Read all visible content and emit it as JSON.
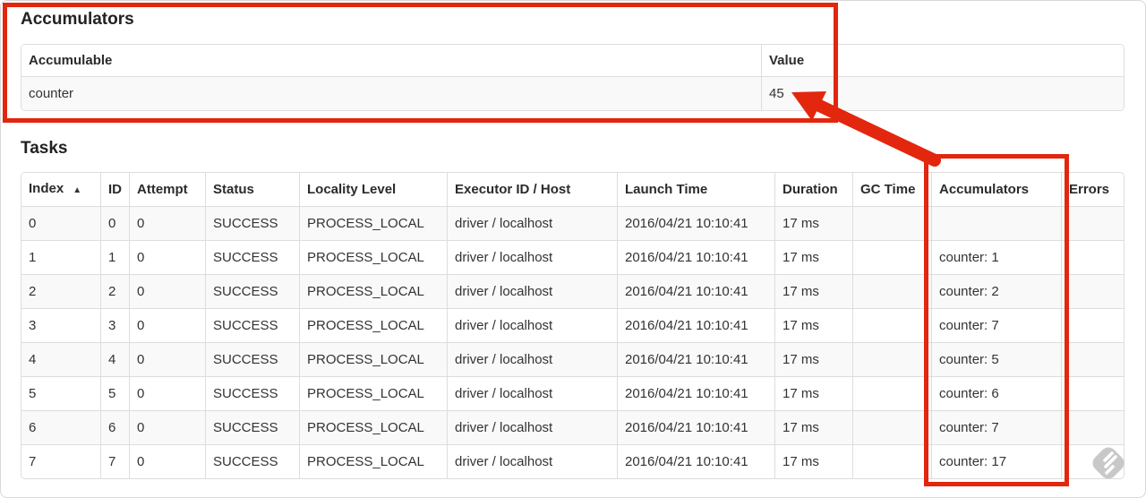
{
  "accumulators_section": {
    "title": "Accumulators",
    "table": {
      "headers": [
        "Accumulable",
        "Value"
      ],
      "rows": [
        [
          "counter",
          "45"
        ]
      ]
    }
  },
  "tasks_section": {
    "title": "Tasks",
    "table": {
      "headers": [
        "Index",
        "ID",
        "Attempt",
        "Status",
        "Locality Level",
        "Executor ID / Host",
        "Launch Time",
        "Duration",
        "GC Time",
        "Accumulators",
        "Errors"
      ],
      "sort_column": 0,
      "sort_glyph": "▲",
      "rows": [
        [
          "0",
          "0",
          "0",
          "SUCCESS",
          "PROCESS_LOCAL",
          "driver / localhost",
          "2016/04/21 10:10:41",
          "17 ms",
          "",
          "",
          ""
        ],
        [
          "1",
          "1",
          "0",
          "SUCCESS",
          "PROCESS_LOCAL",
          "driver / localhost",
          "2016/04/21 10:10:41",
          "17 ms",
          "",
          "counter: 1",
          ""
        ],
        [
          "2",
          "2",
          "0",
          "SUCCESS",
          "PROCESS_LOCAL",
          "driver / localhost",
          "2016/04/21 10:10:41",
          "17 ms",
          "",
          "counter: 2",
          ""
        ],
        [
          "3",
          "3",
          "0",
          "SUCCESS",
          "PROCESS_LOCAL",
          "driver / localhost",
          "2016/04/21 10:10:41",
          "17 ms",
          "",
          "counter: 7",
          ""
        ],
        [
          "4",
          "4",
          "0",
          "SUCCESS",
          "PROCESS_LOCAL",
          "driver / localhost",
          "2016/04/21 10:10:41",
          "17 ms",
          "",
          "counter: 5",
          ""
        ],
        [
          "5",
          "5",
          "0",
          "SUCCESS",
          "PROCESS_LOCAL",
          "driver / localhost",
          "2016/04/21 10:10:41",
          "17 ms",
          "",
          "counter: 6",
          ""
        ],
        [
          "6",
          "6",
          "0",
          "SUCCESS",
          "PROCESS_LOCAL",
          "driver / localhost",
          "2016/04/21 10:10:41",
          "17 ms",
          "",
          "counter: 7",
          ""
        ],
        [
          "7",
          "7",
          "0",
          "SUCCESS",
          "PROCESS_LOCAL",
          "driver / localhost",
          "2016/04/21 10:10:41",
          "17 ms",
          "",
          "counter: 17",
          ""
        ]
      ]
    }
  },
  "annotations": {
    "color": "#e3260e",
    "arrow_target_value": "45"
  },
  "watermark": {
    "color": "#c4c4c4",
    "stripe_color": "#ffffff"
  },
  "colors": {
    "row_stripe": "#f9f9f9",
    "table_border": "#dddddd",
    "text": "#333333"
  }
}
